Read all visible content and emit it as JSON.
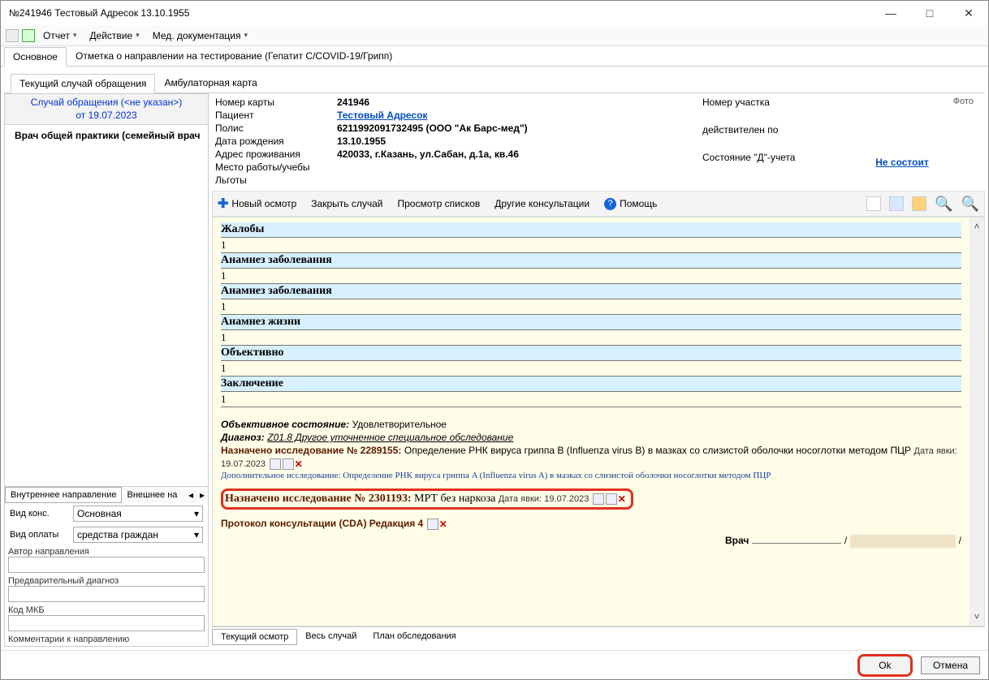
{
  "window_title": "№241946 Тестовый Адресок  13.10.1955",
  "menu": {
    "report": "Отчет",
    "action": "Действие",
    "meddoc": "Мед. документация"
  },
  "top_tabs": {
    "main": "Основное",
    "note": "Отметка о направлении на тестирование (Гепатит С/COVID-19/Грипп)"
  },
  "sub_tabs": {
    "case": "Текущий случай обращения",
    "amb": "Амбулаторная карта"
  },
  "case_header": {
    "l1": "Случай обращения (<не указан>)",
    "l2": "от 19.07.2023"
  },
  "tree_item": "Врач общей практики (семейный врач",
  "ref_tabs": {
    "internal": "Внутреннее направление",
    "external": "Внешнее на"
  },
  "form": {
    "vid_kons_label": "Вид конс.",
    "vid_kons_val": "Основная",
    "vid_opl_label": "Вид оплаты",
    "vid_opl_val": "средства граждан",
    "author": "Автор направления",
    "preddiag": "Предварительный диагноз",
    "mkb": "Код МКБ",
    "comment": "Комментарии к направлению"
  },
  "pi_labels": {
    "card": "Номер карты",
    "pat": "Пациент",
    "polis": "Полис",
    "dob": "Дата рождения",
    "addr": "Адрес проживания",
    "work": "Место работы/учебы",
    "lgoty": "Льготы"
  },
  "pi_values": {
    "card": "241946",
    "pat": "Тестовый Адресок",
    "polis": "6211992091732495 (ООО \"Ак Барс-мед\")",
    "dob": "13.10.1955",
    "addr": "420033, г.Казань, ул.Сабан, д.1а, кв.46"
  },
  "pi_right": {
    "uchastok": "Номер участка",
    "valid": "действителен по",
    "ducheta": "Состояние \"Д\"-учета",
    "nesost": "Не состоит",
    "photo": "Фото"
  },
  "actions": {
    "new": "Новый осмотр",
    "close": "Закрыть случай",
    "lists": "Просмотр списков",
    "other": "Другие консультации",
    "help": "Помощь"
  },
  "sections": {
    "zhaloby": "Жалобы",
    "anam1": "Анамнез заболевания",
    "anam2": "Анамнез заболевания",
    "anamzh": "Анамнез жизни",
    "obj": "Объективно",
    "zakl": "Заключение",
    "val": "1"
  },
  "details": {
    "obj_label": "Объективное состояние:",
    "obj_val": "Удовлетворительное",
    "diag_label": "Диагноз:",
    "diag_val": "Z01.8 Другое уточненное специальное обследование",
    "naz1_label": "Назначено исследование № 2289155:",
    "naz1_val": "Определение РНК вируса гриппа B (Influenza virus B) в мазках со слизистой оболочки носоглотки методом ПЦР",
    "naz1_date_lbl": "Дата явки:",
    "naz1_date": "19.07.2023",
    "dop": "Дополнительное исследование: Определение РНК вируса гриппа A (Influenza virus A) в мазках со слизистой оболочки носоглотки методом ПЦР",
    "naz2_label": "Назначено исследование № 2301193:",
    "naz2_val": "МРТ без наркоза",
    "naz2_date_lbl": "Дата явки:",
    "naz2_date": "19.07.2023",
    "protocol": "Протокол консультации (CDA) Редакция 4",
    "doctor_lbl": "Врач",
    "slash": "/"
  },
  "bottom_tabs": {
    "current": "Текущий осмотр",
    "all": "Весь случай",
    "plan": "План обследования"
  },
  "footer": {
    "ok": "Ok",
    "cancel": "Отмена"
  }
}
